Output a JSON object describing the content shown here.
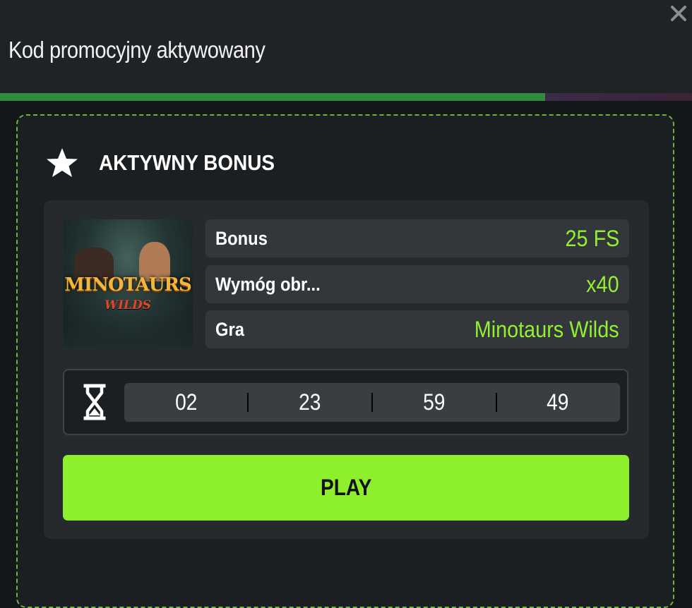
{
  "header": {
    "title": "Kod promocyjny aktywowany",
    "progress_fraction": 0.788,
    "progress_color": "#2f8a3b"
  },
  "bonus": {
    "title": "AKTYWNY BONUS",
    "game_thumbnail": {
      "logo_text": "MINOTAURS",
      "sub_text": "WILDS"
    },
    "rows": [
      {
        "label": "Bonus",
        "value": "25 FS"
      },
      {
        "label": "Wymóg obr...",
        "value": "x40"
      },
      {
        "label": "Gra",
        "value": "Minotaurs Wilds"
      }
    ],
    "timer": [
      "02",
      "23",
      "59",
      "49"
    ],
    "play_label": "PLAY"
  },
  "colors": {
    "accent": "#92f030",
    "button": "#8ef02c",
    "panel_border": "#6fb33c"
  },
  "icons": {
    "close": "close-icon",
    "star": "star-icon",
    "hourglass": "hourglass-icon"
  }
}
